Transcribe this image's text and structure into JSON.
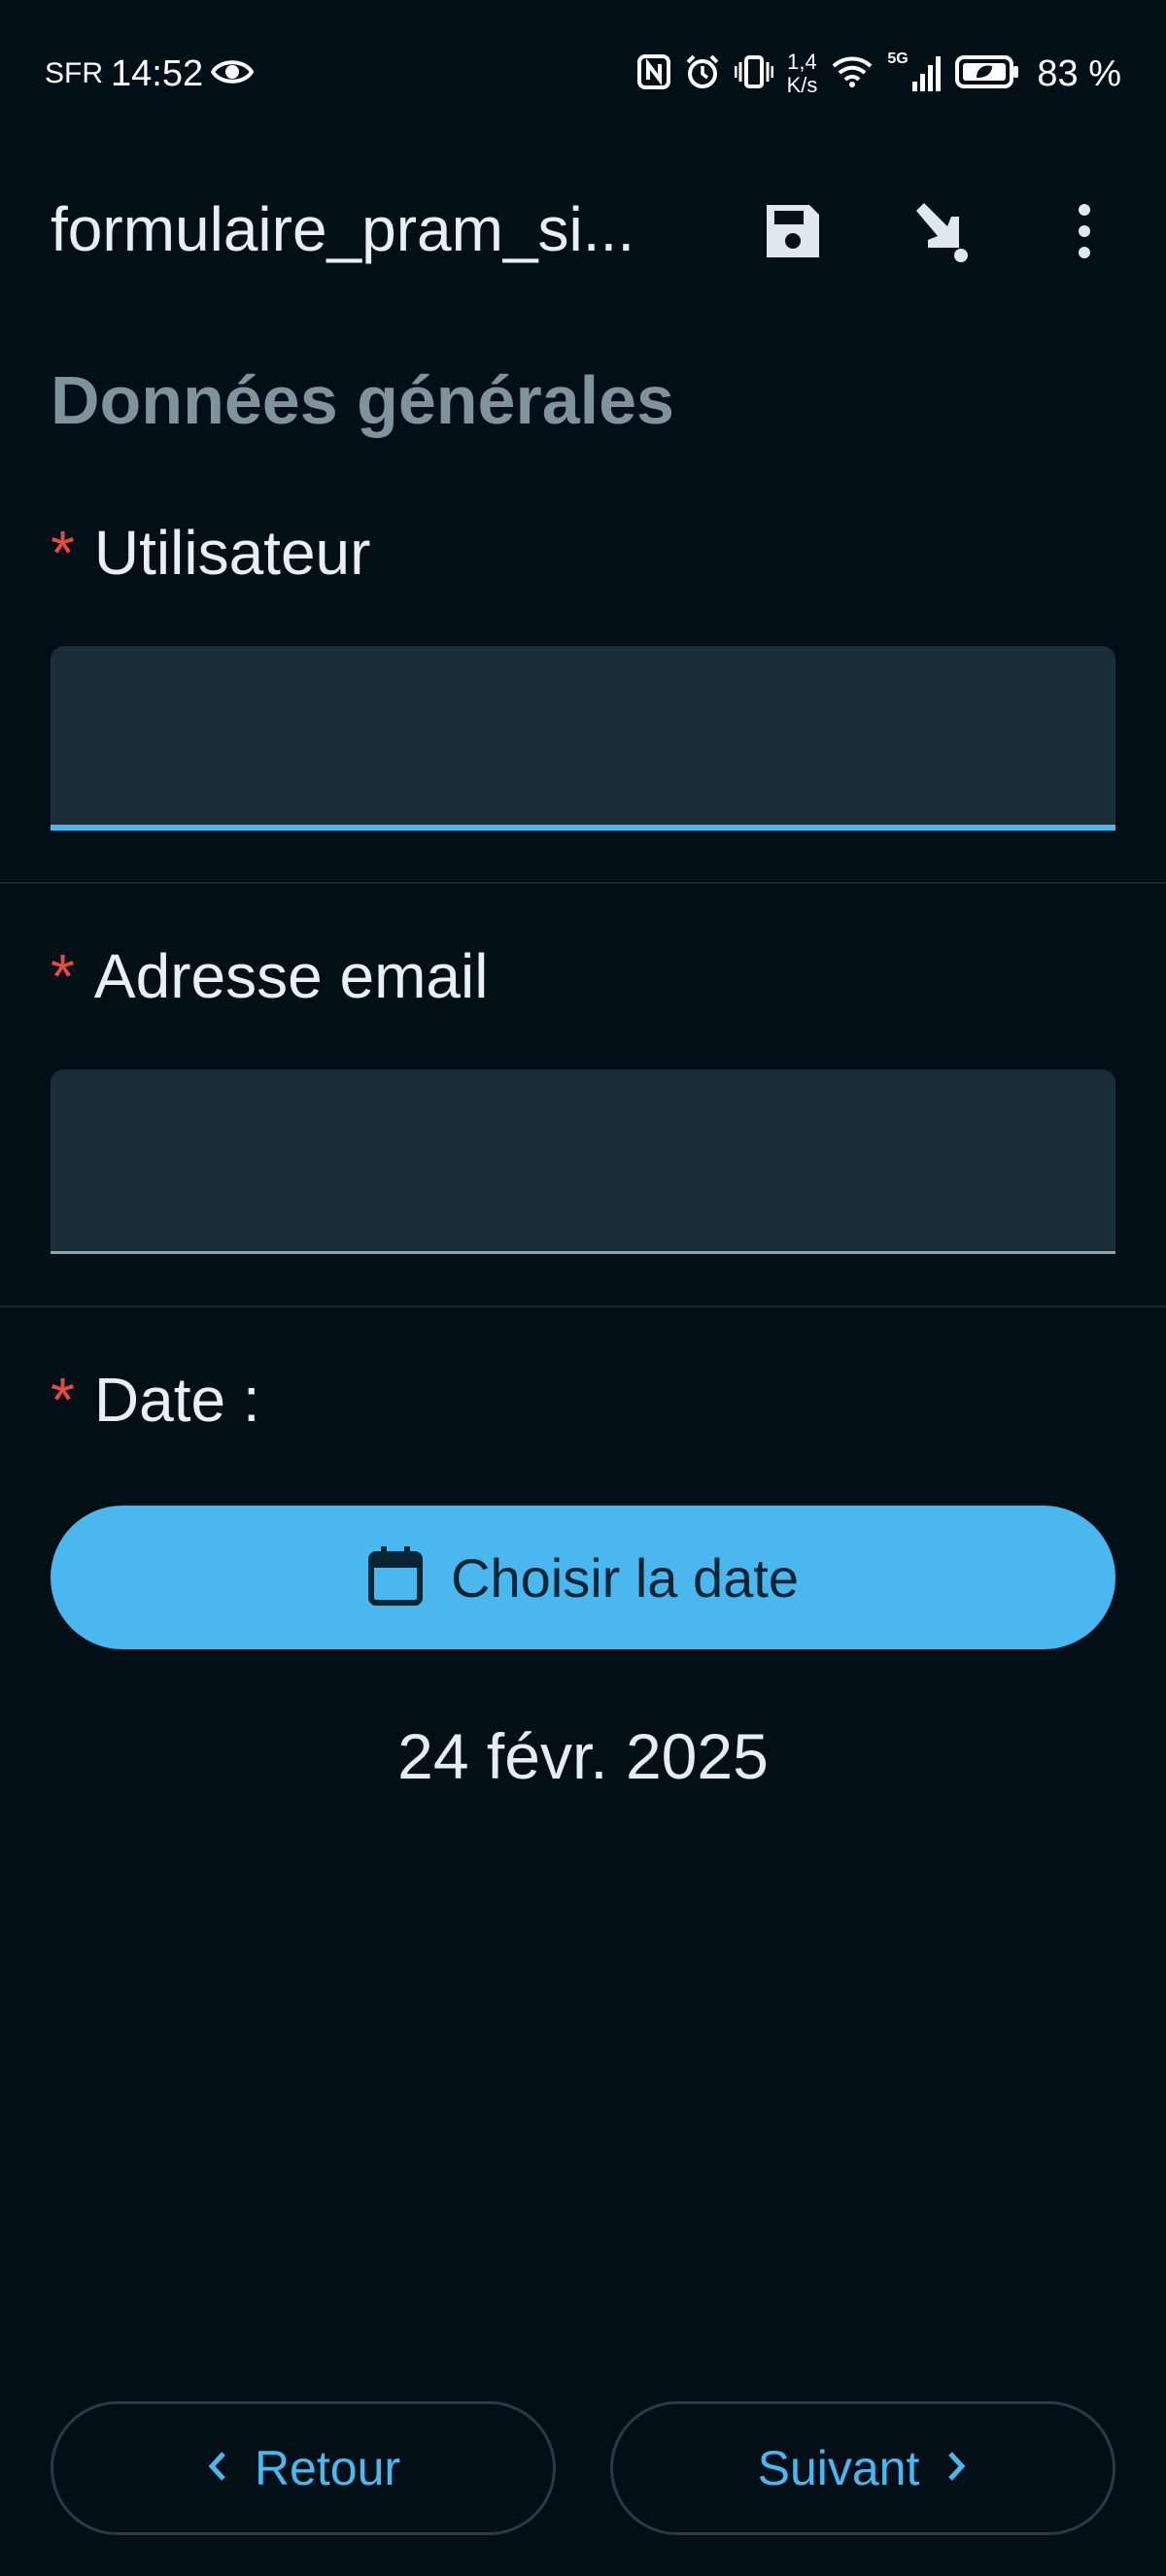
{
  "status_bar": {
    "carrier": "SFR",
    "time": "14:52",
    "speed_value": "1,4",
    "speed_unit": "K/s",
    "network": "5G",
    "battery": "83 %"
  },
  "app_bar": {
    "title": "formulaire_pram_si...",
    "icons": [
      "save-icon",
      "download-arrow-icon",
      "more-vertical-icon"
    ]
  },
  "form": {
    "section_title": "Données générales",
    "required_marker": "*",
    "user_label": "Utilisateur",
    "user_value": "",
    "email_label": "Adresse email",
    "email_value": "",
    "date_label": "Date :",
    "date_button_label": "Choisir la date",
    "date_value": "24 févr. 2025"
  },
  "navigation": {
    "back_label": "Retour",
    "next_label": "Suivant"
  },
  "colors": {
    "background": "#020f17",
    "accent": "#4ab8ef",
    "required": "#ea4a3d",
    "field_fill": "#1a2e3a"
  }
}
